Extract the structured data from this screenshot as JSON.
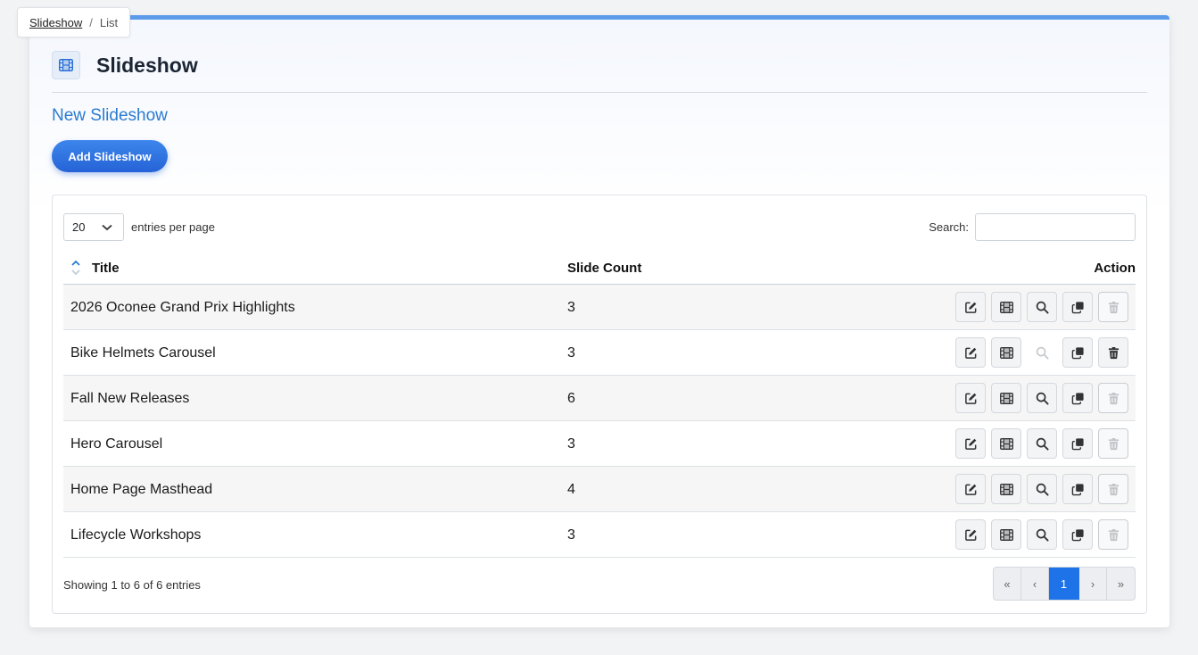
{
  "breadcrumb": {
    "root": "Slideshow",
    "separator": "/",
    "current": "List"
  },
  "page": {
    "title": "Slideshow",
    "subheading": "New Slideshow",
    "add_button": "Add Slideshow",
    "icon": "film-icon"
  },
  "colors": {
    "accent": "#5c9bea",
    "link": "#2a7bd1",
    "button": "#2563d6",
    "active_page": "#1e73e8"
  },
  "table": {
    "entries_per_page": {
      "value": "20",
      "label": "entries per page"
    },
    "search": {
      "label": "Search:",
      "value": "",
      "placeholder": ""
    },
    "columns": {
      "title": "Title",
      "slide_count": "Slide Count",
      "action": "Action"
    },
    "rows": [
      {
        "title": "2026 Oconee Grand Prix Highlights",
        "slide_count": "3",
        "search_enabled": true,
        "delete_enabled": false
      },
      {
        "title": "Bike Helmets Carousel",
        "slide_count": "3",
        "search_enabled": false,
        "delete_enabled": true
      },
      {
        "title": "Fall New Releases",
        "slide_count": "6",
        "search_enabled": true,
        "delete_enabled": false
      },
      {
        "title": "Hero Carousel",
        "slide_count": "3",
        "search_enabled": true,
        "delete_enabled": false
      },
      {
        "title": "Home Page Masthead",
        "slide_count": "4",
        "search_enabled": true,
        "delete_enabled": false
      },
      {
        "title": "Lifecycle Workshops",
        "slide_count": "3",
        "search_enabled": true,
        "delete_enabled": false
      }
    ],
    "footer_info": "Showing 1 to 6 of 6 entries",
    "pagination": {
      "first": "«",
      "prev": "‹",
      "current": "1",
      "next": "›",
      "last": "»"
    }
  }
}
